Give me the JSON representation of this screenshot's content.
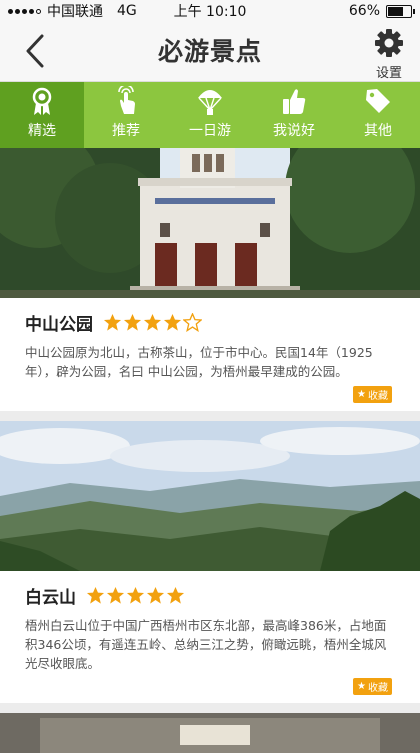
{
  "status_bar": {
    "carrier": "中国联通",
    "network": "4G",
    "time": "上午 10:10",
    "battery_percent": "66%",
    "battery_level": 0.66
  },
  "nav": {
    "title": "必游景点",
    "settings_label": "设置"
  },
  "tabs": [
    {
      "label": "精选",
      "icon": "award-ribbon-icon",
      "active": true
    },
    {
      "label": "推荐",
      "icon": "touch-hand-icon",
      "active": false
    },
    {
      "label": "一日游",
      "icon": "parachute-icon",
      "active": false
    },
    {
      "label": "我说好",
      "icon": "thumbs-up-icon",
      "active": false
    },
    {
      "label": "其他",
      "icon": "tag-icon",
      "active": false
    }
  ],
  "spots": [
    {
      "name": "中山公园",
      "rating": 4,
      "description": "中山公园原为北山，古称茶山，位于市中心。民国14年（1925年），辟为公园，名曰 中山公园，为梧州最早建成的公园。",
      "fav_label": "收藏"
    },
    {
      "name": "白云山",
      "rating": 5,
      "description": "梧州白云山位于中国广西梧州市区东北部，最高峰386米，占地面积346公顷，有遥连五岭、总纳三江之势，俯瞰远眺，梧州全城风光尽收眼底。",
      "fav_label": "收藏"
    }
  ],
  "colors": {
    "tab_green": "#8cc63f",
    "tab_active": "#5fa020",
    "star": "#f2a10f"
  }
}
